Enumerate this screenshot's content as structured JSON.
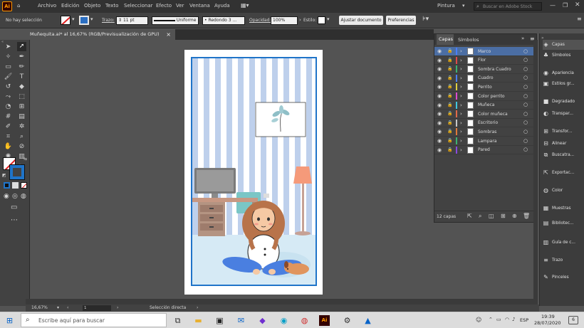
{
  "menubar": {
    "app_icon": "Ai",
    "items": [
      "Archivo",
      "Edición",
      "Objeto",
      "Texto",
      "Seleccionar",
      "Efecto",
      "Ver",
      "Ventana",
      "Ayuda"
    ],
    "workspace": "Pintura",
    "search_placeholder": "Buscar en Adobe Stock"
  },
  "control_bar": {
    "selection": "No hay selección",
    "stroke_label": "Trazo:",
    "stroke_weight": "11 pt",
    "stroke_profile": "Uniforme",
    "brush": "Redondo 3 ...",
    "opacity_label": "Opacidad:",
    "opacity": "100%",
    "style_label": "Estilo:",
    "doc_setup": "Ajustar documento",
    "preferences": "Preferencias"
  },
  "document": {
    "tab_title": "Muñequita.ai* al 16,67% (RGB/Previsualización de GPU)",
    "close": "×"
  },
  "layers_panel": {
    "tabs": [
      "Capas",
      "Símbolos"
    ],
    "layers": [
      {
        "name": "Marco",
        "color": "#4a7fff",
        "selected": true
      },
      {
        "name": "Flor",
        "color": "#e04a4a"
      },
      {
        "name": "Sombra Cuadro",
        "color": "#3cb371"
      },
      {
        "name": "Cuadro",
        "color": "#4a7fff"
      },
      {
        "name": "Perrito",
        "color": "#e0d040"
      },
      {
        "name": "Color perrito",
        "color": "#e04ad0"
      },
      {
        "name": "Muñeca",
        "color": "#40c8e0"
      },
      {
        "name": "Color muñeca",
        "color": "#e06a4a"
      },
      {
        "name": "Escritorio",
        "color": "#c8c8c8"
      },
      {
        "name": "Sombras",
        "color": "#e07a3a"
      },
      {
        "name": "Lampara",
        "color": "#3cb371"
      },
      {
        "name": "Pared",
        "color": "#8a4ae0"
      }
    ],
    "count": "12 capas"
  },
  "dock": {
    "items": [
      {
        "label": "Capas",
        "icon": "layers-icon",
        "glyph": "◈"
      },
      {
        "label": "Símbolos",
        "icon": "symbols-icon",
        "glyph": "♣"
      },
      {
        "label": "Apariencia",
        "icon": "appearance-icon",
        "glyph": "◉"
      },
      {
        "label": "Estilos gr...",
        "icon": "graphic-styles-icon",
        "glyph": "▣"
      },
      {
        "label": "Degradado",
        "icon": "gradient-icon",
        "glyph": "■"
      },
      {
        "label": "Transpar...",
        "icon": "transparency-icon",
        "glyph": "◐"
      },
      {
        "label": "Transfor...",
        "icon": "transform-icon",
        "glyph": "⊞"
      },
      {
        "label": "Alinear",
        "icon": "align-icon",
        "glyph": "⊟"
      },
      {
        "label": "Buscatra...",
        "icon": "pathfinder-icon",
        "glyph": "⧉"
      },
      {
        "label": "Exportac...",
        "icon": "export-icon",
        "glyph": "⇱"
      },
      {
        "label": "Color",
        "icon": "color-icon",
        "glyph": "◍"
      },
      {
        "label": "Muestras",
        "icon": "swatches-icon",
        "glyph": "▦"
      },
      {
        "label": "Bibliotec...",
        "icon": "libraries-icon",
        "glyph": "▤"
      },
      {
        "label": "Guía de c...",
        "icon": "color-guide-icon",
        "glyph": "▥"
      },
      {
        "label": "Trazo",
        "icon": "stroke-icon",
        "glyph": "≡"
      },
      {
        "label": "Pinceles",
        "icon": "brushes-icon",
        "glyph": "✎"
      }
    ]
  },
  "statusbar": {
    "zoom": "16,67%",
    "artboard": "1",
    "tool": "Selección directa"
  },
  "taskbar": {
    "search_placeholder": "Escribe aquí para buscar",
    "time": "19:39",
    "date": "28/07/2020",
    "lang": "ESP",
    "notifications": "6"
  }
}
